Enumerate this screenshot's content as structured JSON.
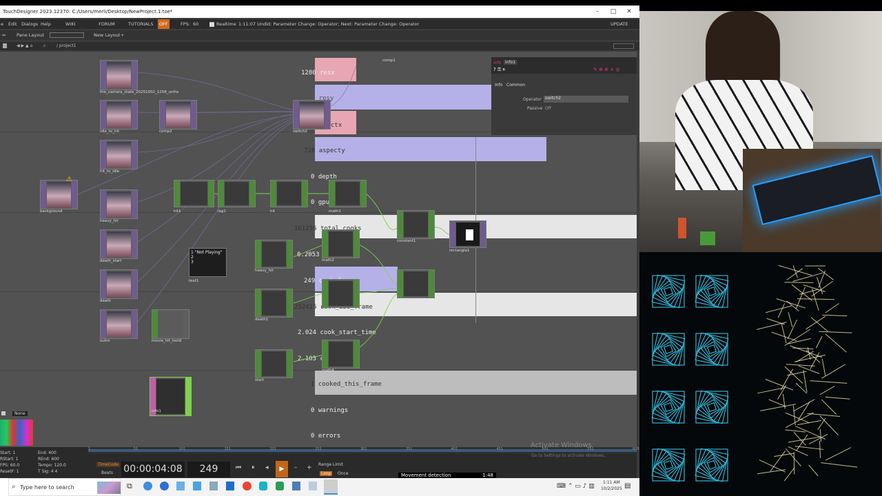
{
  "window": {
    "title": "TouchDesigner 2023.12370: C:/Users/merli/Desktop/NewProject.1.toe*",
    "min": "–",
    "max": "□",
    "close": "✕"
  },
  "menu": {
    "items": [
      "e",
      "Edit",
      "Dialogs",
      "Help",
      "WIKI",
      "FORUM",
      "TUTORIALS",
      "OFF",
      "FPS:",
      "60",
      "Realtime"
    ],
    "status": "1:11:07 Undid: Parameter Change: Operator; Next: Parameter Change: Operator",
    "update": "UPDATE"
  },
  "panebar": {
    "pane_layout": "Pane Layout",
    "new_layout": "New Layout"
  },
  "pathbar": {
    "path": "/ project1"
  },
  "nodes": [
    {
      "id": "the_camera_state",
      "label": "the_camera_state_20251002_1258_unfra"
    },
    {
      "id": "idle_to_hit",
      "label": "idle_to_hit"
    },
    {
      "id": "comp2",
      "label": "comp2"
    },
    {
      "id": "switch2",
      "label": "switch2"
    },
    {
      "id": "hit_to_idle",
      "label": "hit_to_idle"
    },
    {
      "id": "background",
      "label": "background"
    },
    {
      "id": "heavy_hit",
      "label": "heavy_hit"
    },
    {
      "id": "death_start",
      "label": "death_start"
    },
    {
      "id": "death",
      "label": "death"
    },
    {
      "id": "outro",
      "label": "outro"
    },
    {
      "id": "movie_hit",
      "label": "movie_hit_toold"
    },
    {
      "id": "info1",
      "label": "info1"
    },
    {
      "id": "hit1",
      "label": "hit1"
    },
    {
      "id": "lag1",
      "label": "lag1"
    },
    {
      "id": "hit",
      "label": "hit"
    },
    {
      "id": "math1",
      "label": "math1"
    },
    {
      "id": "heavy_hit2",
      "label": "heavy_hit"
    },
    {
      "id": "math2",
      "label": "math2"
    },
    {
      "id": "death1",
      "label": "death1"
    },
    {
      "id": "math3",
      "label": "math3"
    },
    {
      "id": "start",
      "label": "start"
    },
    {
      "id": "math4",
      "label": "math4"
    },
    {
      "id": "constant1",
      "label": "constant1"
    },
    {
      "id": "rectangle1",
      "label": "rectangle1"
    },
    {
      "id": "math5",
      "label": "math5"
    },
    {
      "id": "text1",
      "label": "text1"
    },
    {
      "id": "comp1",
      "label": "comp1"
    }
  ],
  "text_node": {
    "line1": "1 \"Not Playing\"",
    "line2": "2",
    "line3": "3"
  },
  "info_rows": [
    {
      "value": "1280",
      "name": "resx"
    },
    {
      "value": "720",
      "name": "resy"
    },
    {
      "value": "",
      "name": "ctx"
    },
    {
      "value": "720",
      "name": "aspecty"
    },
    {
      "value": "0",
      "name": "depth"
    },
    {
      "value": "0",
      "name": "gpu_"
    },
    {
      "value": "161256",
      "name": "total_cooks"
    },
    {
      "value": "0.2053",
      "name": "co"
    },
    {
      "value": "249",
      "name": "cook_f"
    },
    {
      "value": "252415",
      "name": "cook_abs_frame"
    },
    {
      "value": "2.024",
      "name": "cook_start_time"
    },
    {
      "value": "2.103",
      "name": "co"
    },
    {
      "value": "1",
      "name": "cooked_this_frame"
    },
    {
      "value": "0",
      "name": "warnings"
    },
    {
      "value": "0",
      "name": "errors"
    }
  ],
  "info_panel": {
    "header": "Info",
    "name": "info1",
    "tabs": [
      "Info",
      "Common"
    ],
    "operator_label": "Operator",
    "operator_value": "switch2",
    "passive_label": "Passive",
    "passive_value": "Off"
  },
  "palette": {
    "none": "None"
  },
  "timeline": {
    "start_label": "Start:",
    "start": "1",
    "end_label": "End:",
    "end": "600",
    "rstart_label": "RStart:",
    "rstart": "1",
    "rend_label": "REnd:",
    "rend": "600",
    "fps_label": "FPS:",
    "fps": "60.0",
    "tempo_label": "Tempo:",
    "tempo": "120.0",
    "reset_label": "ResetF:",
    "reset": "1",
    "tsig_label": "T Sig:",
    "tsig": "4    4",
    "timecode_btn": "TimeCode",
    "beats_btn": "Beats",
    "timecode": "00:00:04:08",
    "frame": "249",
    "range_limit": "Range Limit",
    "loop": "Loop",
    "once": "Once",
    "ticks": [
      "1",
      "51",
      "101",
      "151",
      "201",
      "251",
      "301",
      "351",
      "401",
      "451",
      "501",
      "551",
      "600"
    ]
  },
  "watermark": {
    "line1": "Activate Windows",
    "line2": "Go to Settings to activate Windows."
  },
  "overlay": {
    "text": "Movement detection",
    "value": "1:48"
  },
  "taskbar": {
    "search": "Type here to search",
    "time": "1:11 AM",
    "date": "10/2/2025"
  },
  "colors": {
    "purple_bar": "#b5b1e8",
    "pink_bar": "#e8a6b3",
    "white_bar": "#e6e6e6",
    "grey_bar": "#bdbdbd",
    "accent": "#e0347f"
  }
}
